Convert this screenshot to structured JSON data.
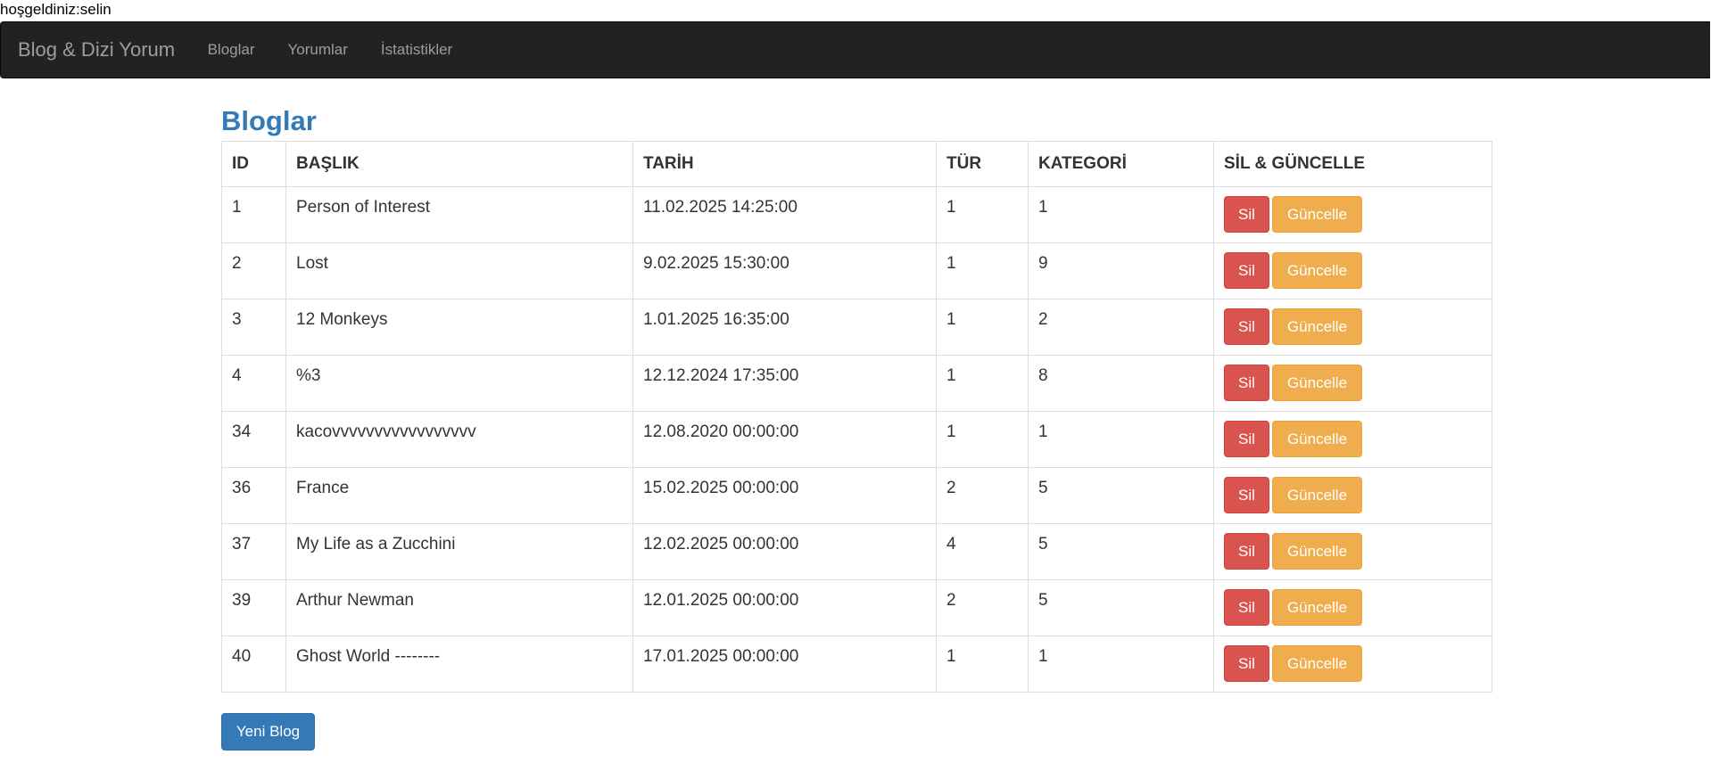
{
  "welcome": "hoşgeldiniz:selin",
  "navbar": {
    "brand": "Blog & Dizi Yorum",
    "links": [
      "Bloglar",
      "Yorumlar",
      "İstatistikler"
    ]
  },
  "page": {
    "title": "Bloglar",
    "new_button": "Yeni Blog"
  },
  "table": {
    "headers": [
      "ID",
      "BAŞLIK",
      "TARİH",
      "TÜR",
      "KATEGORİ",
      "SİL & GÜNCELLE"
    ],
    "delete_label": "Sil",
    "update_label": "Güncelle",
    "rows": [
      {
        "id": "1",
        "title": "Person of Interest",
        "date": "11.02.2025 14:25:00",
        "type": "1",
        "category": "1"
      },
      {
        "id": "2",
        "title": "Lost",
        "date": "9.02.2025 15:30:00",
        "type": "1",
        "category": "9"
      },
      {
        "id": "3",
        "title": "12 Monkeys",
        "date": "1.01.2025 16:35:00",
        "type": "1",
        "category": "2"
      },
      {
        "id": "4",
        "title": "%3",
        "date": "12.12.2024 17:35:00",
        "type": "1",
        "category": "8"
      },
      {
        "id": "34",
        "title": "kacovvvvvvvvvvvvvvvvv",
        "date": "12.08.2020 00:00:00",
        "type": "1",
        "category": "1"
      },
      {
        "id": "36",
        "title": "France",
        "date": "15.02.2025 00:00:00",
        "type": "2",
        "category": "5"
      },
      {
        "id": "37",
        "title": "My Life as a Zucchini",
        "date": "12.02.2025 00:00:00",
        "type": "4",
        "category": "5"
      },
      {
        "id": "39",
        "title": "Arthur Newman",
        "date": "12.01.2025 00:00:00",
        "type": "2",
        "category": "5"
      },
      {
        "id": "40",
        "title": "Ghost World --------",
        "date": "17.01.2025 00:00:00",
        "type": "1",
        "category": "1"
      }
    ]
  },
  "colors": {
    "navbar_bg": "#222222",
    "title": "#337ab7",
    "delete": "#d9534f",
    "update": "#f0ad4e",
    "primary": "#337ab7"
  }
}
